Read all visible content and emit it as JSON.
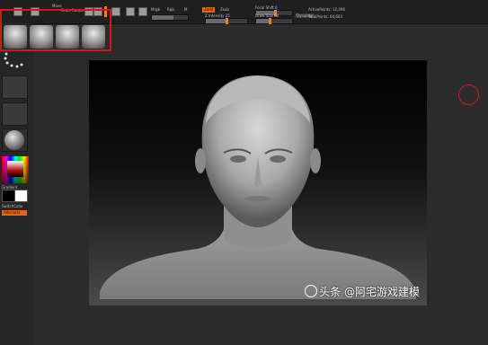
{
  "topbar": {
    "tiny_labels": [
      "Edit",
      "Move",
      "Scale",
      "Rotate",
      "Mrgb",
      "Rgb",
      "M",
      "Zadd",
      "Zsub",
      "Focal Shift",
      "Draw Size",
      "Z Intensity",
      "Rgb Intensity",
      "ActivePoints",
      "TotalPoints",
      "Dynamic"
    ],
    "zadd": "Zadd",
    "focal_shift": "Focal Shift 0",
    "draw_size": "Draw Size 64",
    "z_intensity": "Z Intensity 25",
    "active_points": "ActivePoints: 12,496",
    "total_points": "TotalPoints: 64,603",
    "dynamic": "Dynamic"
  },
  "left_panel": {
    "gradient_label": "Gradient",
    "switch_color_label": "SwitchColor",
    "alternate_label": "Alternate"
  },
  "watermark": {
    "text": "头条 @阿宅游戏建模"
  }
}
